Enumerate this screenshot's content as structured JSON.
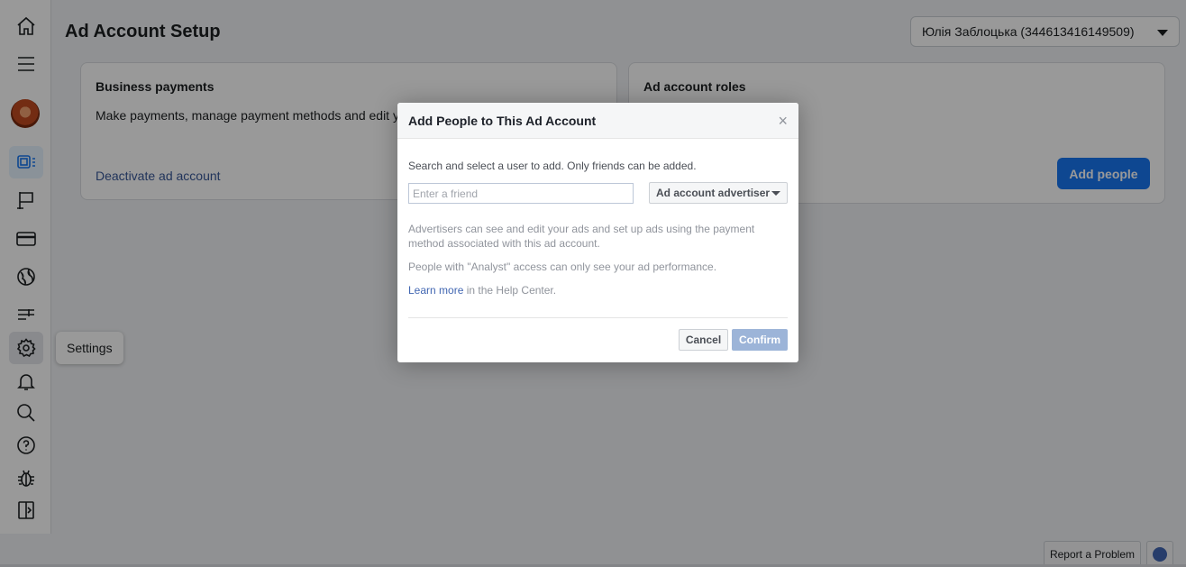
{
  "header": {
    "title": "Ad Account Setup",
    "account_selector": "Юлія Заблоцька (344613416149509)"
  },
  "sidebar": {
    "items": [
      {
        "icon": "home-icon"
      },
      {
        "icon": "menu-icon"
      },
      {
        "icon": "avatar"
      },
      {
        "icon": "ads-manager-icon",
        "active": true
      },
      {
        "icon": "flag-icon"
      },
      {
        "icon": "credit-card-icon"
      },
      {
        "icon": "globe-icon"
      },
      {
        "icon": "sliders-icon"
      },
      {
        "icon": "gear-icon",
        "tooltip": "Settings"
      },
      {
        "icon": "bell-icon"
      },
      {
        "icon": "search-icon"
      },
      {
        "icon": "help-icon"
      },
      {
        "icon": "bug-icon"
      },
      {
        "icon": "panel-toggle-icon"
      }
    ],
    "tooltip": "Settings"
  },
  "cards": {
    "business_payments": {
      "title": "Business payments",
      "description": "Make payments, manage payment methods and edit y",
      "link": "Deactivate ad account"
    },
    "ad_account_roles": {
      "title": "Ad account roles",
      "button": "Add people"
    }
  },
  "modal": {
    "title": "Add People to This Ad Account",
    "close": "×",
    "instruction": "Search and select a user to add. Only friends can be added.",
    "input_placeholder": "Enter a friend",
    "role": "Ad account advertiser",
    "text1": "Advertisers can see and edit your ads and set up ads using the payment method associated with this ad account.",
    "text2": "People with \"Analyst\" access can only see your ad performance.",
    "learn_more": "Learn more",
    "learn_more_suffix": " in the Help Center.",
    "cancel": "Cancel",
    "confirm": "Confirm"
  },
  "footer": {
    "report": "Report a Problem"
  },
  "colors": {
    "brand_blue": "#1877f2",
    "link_blue": "#385898",
    "confirm_disabled": "#9cb4d8"
  }
}
